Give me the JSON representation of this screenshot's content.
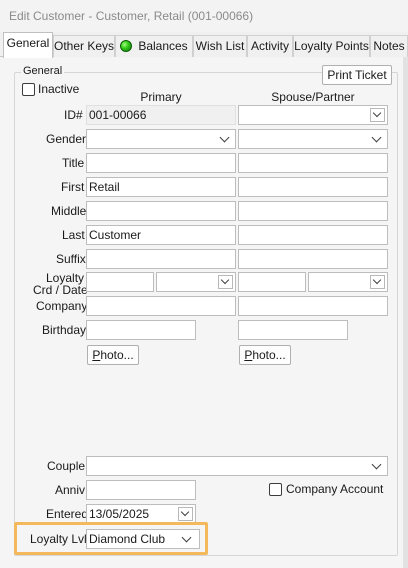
{
  "window": {
    "title": "Edit Customer - Customer, Retail (001-00066)"
  },
  "tabs": [
    {
      "label": "General",
      "active": true
    },
    {
      "label": "Other Keys"
    },
    {
      "label": "Balances",
      "icon": "green-ball-icon"
    },
    {
      "label": "Wish List"
    },
    {
      "label": "Activity"
    },
    {
      "label": "Loyalty Points"
    },
    {
      "label": "Notes"
    }
  ],
  "general": {
    "group_label": "General",
    "inactive_label": "Inactive",
    "inactive_checked": false,
    "print_ticket_label": "Print Ticket",
    "col_primary": "Primary",
    "col_spouse": "Spouse/Partner",
    "labels": {
      "id": "ID#",
      "gender": "Gender",
      "title": "Title",
      "first": "First",
      "middle": "Middle",
      "last": "Last",
      "suffix": "Suffix",
      "loyalty_crd_line1": "Loyalty",
      "loyalty_crd_line2": "Crd / Date",
      "company": "Company",
      "birthday": "Birthday",
      "couple": "Couple",
      "anniv": "Anniv",
      "entered": "Entered",
      "loyalty_lvl": "Loyalty Lvl"
    },
    "primary": {
      "id": "001-00066",
      "gender": "",
      "title": "",
      "first": "Retail",
      "middle": "",
      "last": "Customer",
      "suffix": "",
      "loyalty_card": "",
      "loyalty_date": "",
      "company": "",
      "birthday": ""
    },
    "spouse": {
      "id": "",
      "gender": "",
      "title": "",
      "first": "",
      "middle": "",
      "last": "",
      "suffix": "",
      "loyalty_card": "",
      "loyalty_date": "",
      "company": "",
      "birthday": ""
    },
    "photo_label_prefix": "P",
    "photo_label_rest": "hoto...",
    "couple": "",
    "anniv": "",
    "company_account_label": "Company Account",
    "company_account_checked": false,
    "entered": "13/05/2025",
    "loyalty_lvl": "Diamond Club"
  },
  "colors": {
    "highlight": "#f4b95c",
    "active_tab": "#ffffff",
    "panel": "#f5f5f5"
  }
}
